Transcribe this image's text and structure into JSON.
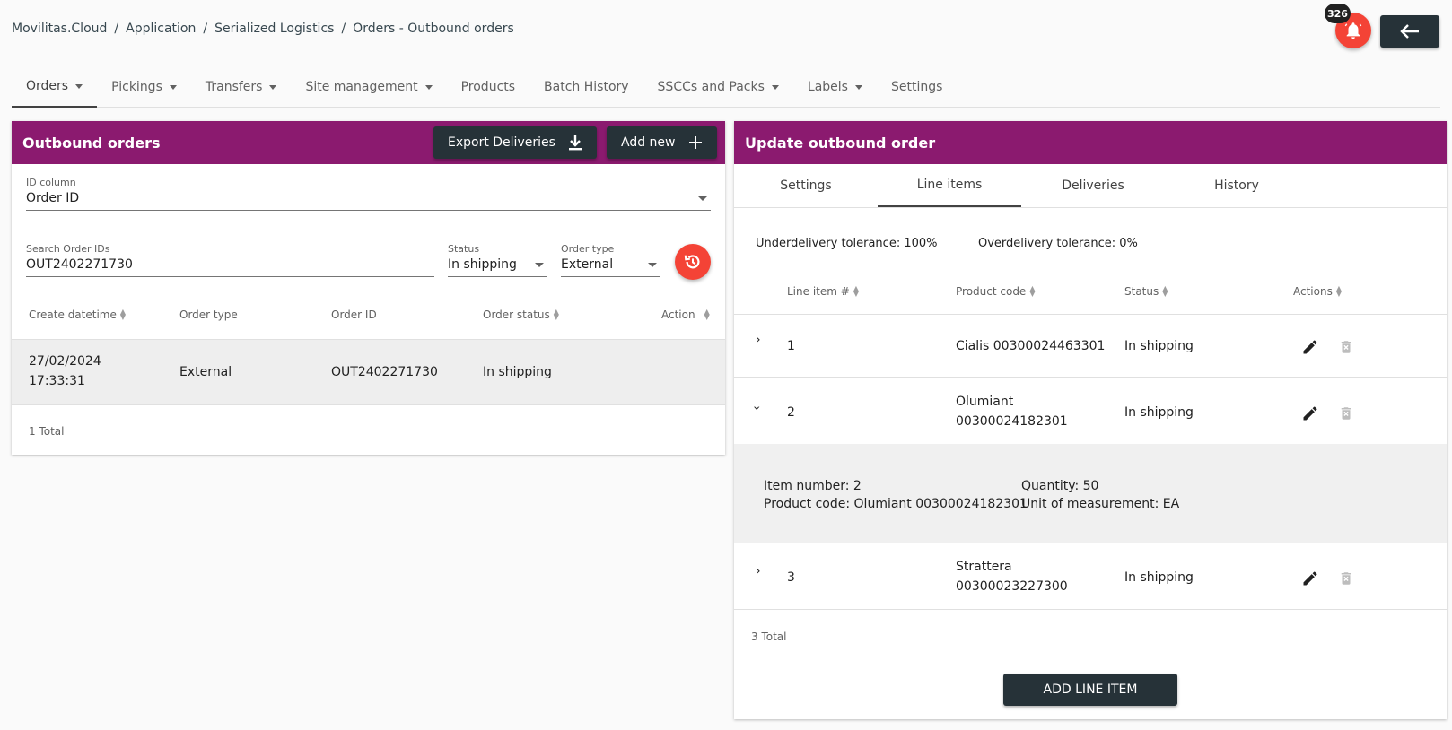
{
  "breadcrumb": [
    "Movilitas.Cloud",
    "Application",
    "Serialized Logistics",
    "Orders - Outbound orders"
  ],
  "notifications": {
    "count": "326"
  },
  "nav": [
    {
      "label": "Orders",
      "dropdown": true
    },
    {
      "label": "Pickings",
      "dropdown": true
    },
    {
      "label": "Transfers",
      "dropdown": true
    },
    {
      "label": "Site management",
      "dropdown": true
    },
    {
      "label": "Products",
      "dropdown": false
    },
    {
      "label": "Batch History",
      "dropdown": false
    },
    {
      "label": "SSCCs and Packs",
      "dropdown": true
    },
    {
      "label": "Labels",
      "dropdown": true
    },
    {
      "label": "Settings",
      "dropdown": false
    }
  ],
  "left": {
    "title": "Outbound orders",
    "export_label": "Export Deliveries",
    "add_label": "Add new",
    "id_column": {
      "label": "ID column",
      "value": "Order ID"
    },
    "search": {
      "label": "Search Order IDs",
      "value": "OUT2402271730"
    },
    "status": {
      "label": "Status",
      "value": "In shipping"
    },
    "order_type": {
      "label": "Order type",
      "value": "External"
    },
    "columns": [
      "Create datetime",
      "Order type",
      "Order ID",
      "Order status",
      "Action"
    ],
    "rows": [
      {
        "date": "27/02/2024",
        "time": "17:33:31",
        "type": "External",
        "id": "OUT2402271730",
        "status": "In shipping"
      }
    ],
    "total": "1 Total"
  },
  "right": {
    "title": "Update outbound order",
    "tabs": [
      "Settings",
      "Line items",
      "Deliveries",
      "History"
    ],
    "underdelivery": "Underdelivery tolerance: 100%",
    "overdelivery": "Overdelivery tolerance: 0%",
    "columns": [
      "Line item #",
      "Product code",
      "Status",
      "Actions"
    ],
    "rows": [
      {
        "num": "1",
        "product_line1": "Cialis 00300024463301",
        "product_line2": "",
        "status": "In shipping"
      },
      {
        "num": "2",
        "product_line1": "Olumiant",
        "product_line2": "00300024182301",
        "status": "In shipping"
      },
      {
        "num": "3",
        "product_line1": "Strattera",
        "product_line2": "00300023227300",
        "status": "In shipping"
      }
    ],
    "detail": {
      "item_number": "Item number: 2",
      "product_code": "Product code: Olumiant 00300024182301",
      "quantity": "Quantity: 50",
      "uom": "Unit of measurement: EA"
    },
    "total": "3 Total",
    "add_line_label": "ADD LINE ITEM"
  },
  "colors": {
    "header": "#8b1a6f",
    "dark_button": "#263238",
    "danger": "#f44336"
  }
}
